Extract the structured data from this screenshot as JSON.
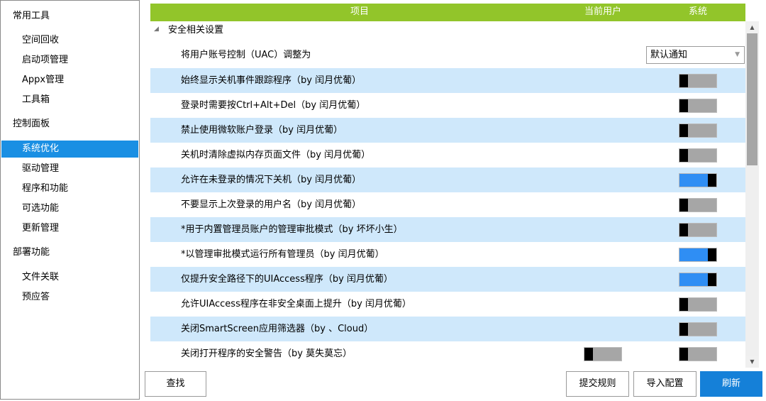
{
  "sidebar": {
    "groups": [
      {
        "label": "常用工具",
        "items": [
          {
            "label": "空间回收"
          },
          {
            "label": "启动项管理"
          },
          {
            "label": "Appx管理"
          },
          {
            "label": "工具箱"
          }
        ]
      },
      {
        "label": "控制面板",
        "items": [
          {
            "label": "系统优化",
            "active": true
          },
          {
            "label": "驱动管理"
          },
          {
            "label": "程序和功能"
          },
          {
            "label": "可选功能"
          },
          {
            "label": "更新管理"
          }
        ]
      },
      {
        "label": "部署功能",
        "items": [
          {
            "label": "文件关联"
          },
          {
            "label": "预应答"
          }
        ]
      }
    ]
  },
  "table": {
    "columns": {
      "item": "项目",
      "current_user": "当前用户",
      "system": "系统"
    },
    "section": "安全相关设置",
    "uac": {
      "label": "将用户账号控制（UAC）调整为",
      "value": "默认通知"
    },
    "rows": [
      {
        "label": "始终显示关机事件跟踪程序（by 闰月优葡）",
        "system": "off"
      },
      {
        "label": "登录时需要按Ctrl+Alt+Del（by 闰月优葡）",
        "system": "off"
      },
      {
        "label": "禁止使用微软账户登录（by 闰月优葡）",
        "system": "off"
      },
      {
        "label": "关机时清除虚拟内存页面文件（by 闰月优葡）",
        "system": "off"
      },
      {
        "label": "允许在未登录的情况下关机（by 闰月优葡）",
        "system": "on"
      },
      {
        "label": "不要显示上次登录的用户名（by 闰月优葡）",
        "system": "off"
      },
      {
        "label": "*用于内置管理员账户的管理审批模式（by 坏坏小生）",
        "system": "off"
      },
      {
        "label": "*以管理审批模式运行所有管理员（by 闰月优葡）",
        "system": "on"
      },
      {
        "label": "仅提升安全路径下的UIAccess程序（by 闰月优葡）",
        "system": "on"
      },
      {
        "label": "允许UIAccess程序在非安全桌面上提升（by 闰月优葡）",
        "system": "off"
      },
      {
        "label": "关闭SmartScreen应用筛选器（by 、Cloud）",
        "system": "off"
      },
      {
        "label": "关闭打开程序的安全警告（by 莫失莫忘）",
        "system": "off",
        "current_user": "off"
      }
    ]
  },
  "buttons": {
    "find": "查找",
    "submit_rules": "提交规则",
    "import_config": "导入配置",
    "refresh": "刷新"
  },
  "icons": {
    "collapse": "triangle-collapse-icon",
    "dropdown": "chevron-down-icon",
    "scroll_up": "scroll-up-icon",
    "scroll_down": "scroll-down-icon"
  },
  "colors": {
    "header": "#92c52a",
    "accent": "#1a8fe3",
    "row_alt": "#cfe8fb",
    "toggle_on": "#2f8ef4",
    "toggle_off": "#a6a6a6"
  }
}
